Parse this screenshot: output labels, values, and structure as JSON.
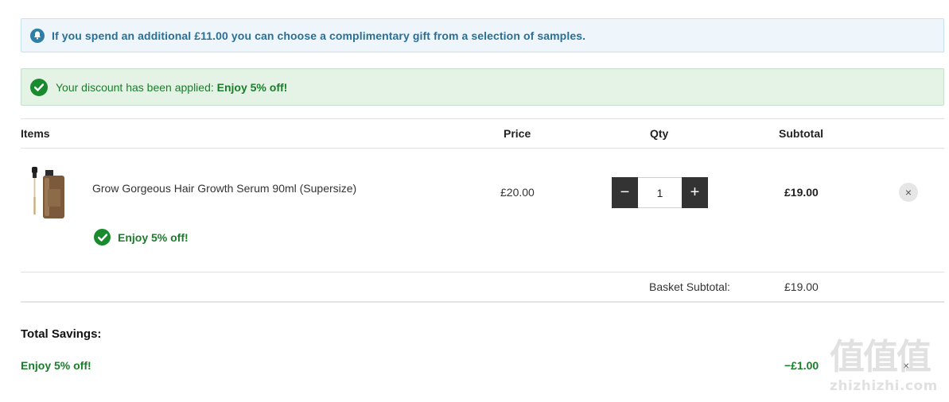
{
  "info_banner": {
    "icon": "bell-icon",
    "text": "If you spend an additional £11.00 you can choose a complimentary gift from a selection of samples."
  },
  "discount_banner": {
    "icon": "check-circle-icon",
    "prefix": "Your discount has been applied:",
    "offer": "Enjoy 5% off!"
  },
  "table_headers": {
    "items": "Items",
    "price": "Price",
    "qty": "Qty",
    "subtotal": "Subtotal"
  },
  "cart_items": [
    {
      "name": "Grow Gorgeous Hair Growth Serum 90ml (Supersize)",
      "price": "£20.00",
      "quantity": "1",
      "subtotal": "£19.00",
      "discount": "Enjoy 5% off!",
      "decrement_symbol": "−",
      "increment_symbol": "+",
      "remove_symbol": "×"
    }
  ],
  "basket": {
    "label": "Basket Subtotal:",
    "value": "£19.00"
  },
  "savings": {
    "title": "Total Savings:",
    "name": "Enjoy 5% off!",
    "amount": "−£1.00",
    "remove_symbol": "×"
  },
  "watermark": {
    "logo_text": "值值值",
    "url": "zhizhizhi.com"
  },
  "colors": {
    "info_text": "#2a6f96",
    "success_green": "#1a7d2a",
    "qty_button": "#333333"
  }
}
